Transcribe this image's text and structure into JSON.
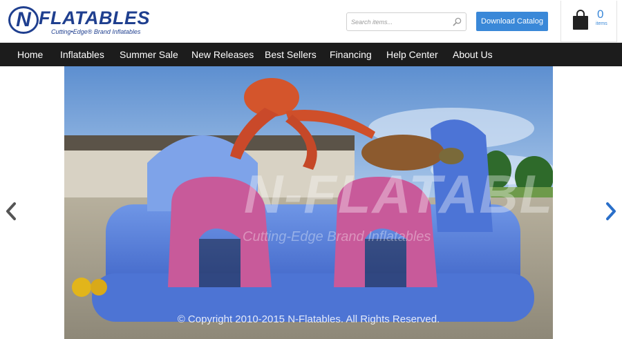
{
  "header": {
    "logo_word": "FLATABLES",
    "logo_letter": "N",
    "logo_tagline": "Cutting•Edge® Brand Inflatables",
    "search_placeholder": "Search items...",
    "download_label": "Download Catalog",
    "cart": {
      "count": "0",
      "label": "items"
    }
  },
  "nav": {
    "items": [
      {
        "label": "Home"
      },
      {
        "label": "Inflatables"
      },
      {
        "label": "Summer Sale"
      },
      {
        "label": "New Releases"
      },
      {
        "label": "Best Sellers"
      },
      {
        "label": "Financing"
      },
      {
        "label": "Help Center"
      },
      {
        "label": "About Us"
      }
    ]
  },
  "slider": {
    "watermark_word": "N-FLATABLES",
    "watermark_tag": "Cutting-Edge Brand Inflatables",
    "copyright": "© Copyright 2010-2015 N-Flatables. All Rights Reserved."
  },
  "colors": {
    "brand_blue": "#1f3f8f",
    "accent_blue": "#3a88d8",
    "nav_bg": "#1c1c1c"
  },
  "icons": {
    "search": "magnifier-icon",
    "cart": "shopping-bag-icon",
    "prev": "chevron-left-icon",
    "next": "chevron-right-icon"
  }
}
